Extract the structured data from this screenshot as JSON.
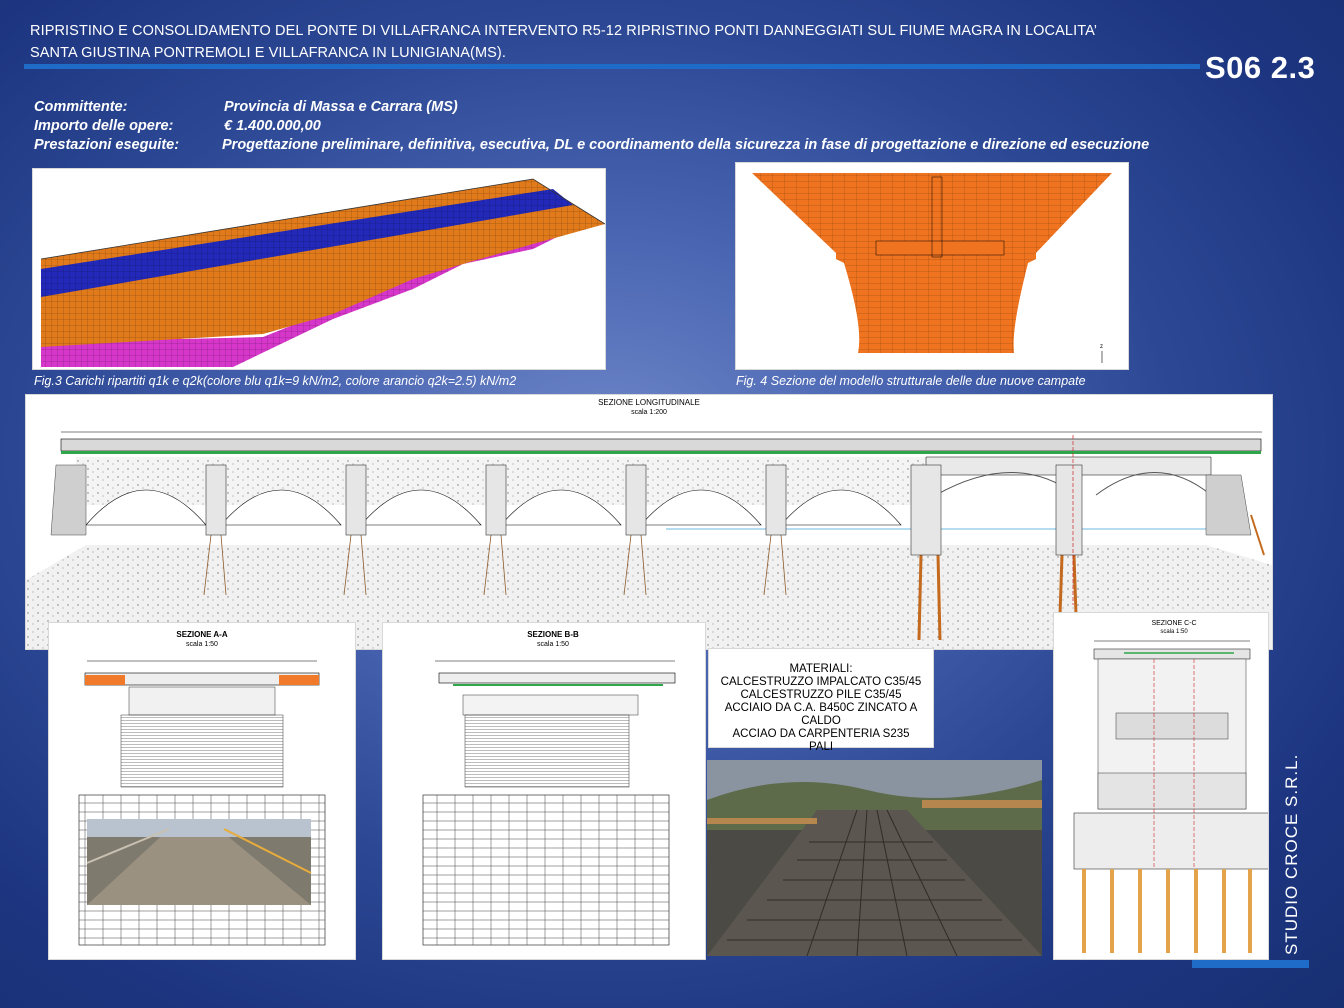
{
  "header": {
    "title_line1": "RIPRISTINO E CONSOLIDAMENTO DEL PONTE DI VILLAFRANCA INTERVENTO R5-12 RIPRISTINO PONTI DANNEGGIATI SUL FIUME MAGRA IN LOCALITA’",
    "title_line2": "SANTA GIUSTINA PONTREMOLI E VILLAFRANCA IN LUNIGIANA(MS).",
    "code": "S06 2.3"
  },
  "info": {
    "committente_label": "Committente:",
    "committente_value": "Provincia di Massa e Carrara (MS)",
    "importo_label": "Importo delle opere:",
    "importo_value": "€ 1.400.000,00",
    "prestazioni_label": "Prestazioni eseguite:",
    "prestazioni_value": "Progettazione preliminare, definitiva, esecutiva, DL e coordinamento della sicurezza in fase di progettazione e direzione ed esecuzione"
  },
  "figures": {
    "fig3_caption": "Fig.3 Carichi ripartiti q1k e q2k(colore blu q1k=9 kN/m2, colore arancio q2k=2.5) kN/m2",
    "fig4_caption": "Fig. 4 Sezione del modello strutturale delle due nuove campate"
  },
  "drawing": {
    "long_title": "SEZIONE LONGITUDINALE",
    "long_scale": "scala 1:200",
    "sec_aa_title": "SEZIONE A-A",
    "sec_aa_scale": "scala 1:50",
    "sec_bb_title": "SEZIONE B-B",
    "sec_bb_scale": "scala 1:50",
    "sec_cc_title": "SEZIONE C-C",
    "sec_cc_scale": "scala 1:50"
  },
  "materials": {
    "title": "MATERIALI:",
    "lines": [
      "CALCESTRUZZO IMPALCATO C35/45",
      "CALCESTRUZZO PILE   C35/45",
      "ACCIAIO DA C.A. B450C ZINCATO A CALDO",
      "ACCIAO DA CARPENTERIA S235",
      "PALI"
    ]
  },
  "footer": {
    "studio": "STUDIO CROCE S.R.L."
  },
  "colors": {
    "title_bar": "#1f6cc8",
    "load_blue": "#2229b8",
    "load_orange": "#e07a1a",
    "model_magenta": "#d636c9"
  }
}
